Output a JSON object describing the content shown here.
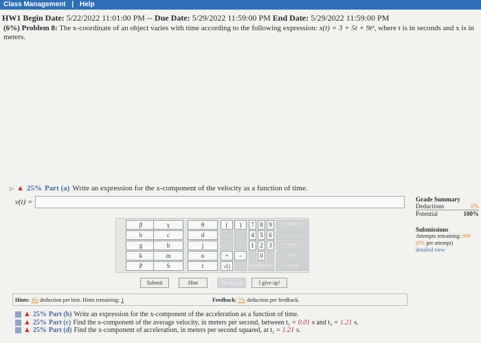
{
  "topbar": {
    "class_management": "Class Management",
    "separator": "|",
    "help": "Help"
  },
  "dates": {
    "hw": "HW1",
    "begin_label": "Begin Date:",
    "begin": "5/22/2022 11:01:00 PM",
    "dash": "--",
    "due_label": "Due Date:",
    "due": "5/29/2022 11:59:00 PM",
    "end_label": "End Date:",
    "end": "5/29/2022 11:59:00 PM"
  },
  "problem": {
    "heading": "(6%) Problem 8:",
    "text_1": "The x-coordinate of an object varies with time according to the following expression:",
    "expression": "x(t) = 3 + 5t + 9t²",
    "text_2": ", where t is in seconds and x is in",
    "text_3": "meters."
  },
  "part_a": {
    "pct": "25%",
    "label": "Part (a)",
    "question": "Write an expression for the x-component of the velocity as a function of time.",
    "answer_label": "v(t) =",
    "answer_value": ""
  },
  "grade_summary": {
    "title": "Grade Summary",
    "deductions_label": "Deductions",
    "deductions_value": "0%",
    "potential_label": "Potential",
    "potential_value": "100%"
  },
  "submissions": {
    "title": "Submissions",
    "attempts_label": "Attempts remaining:",
    "attempts_value": "999",
    "per_attempt_pct": "(0%",
    "per_attempt_text": "per attempt)",
    "detailed_view": "detailed view"
  },
  "keypad": {
    "vars": [
      [
        "β",
        "γ",
        "θ"
      ],
      [
        "b",
        "c",
        "d"
      ],
      [
        "g",
        "h",
        "j"
      ],
      [
        "k",
        "m",
        "n"
      ],
      [
        "P",
        "S",
        "t"
      ]
    ],
    "open_paren": "(",
    "close_paren": ")",
    "digits": [
      [
        "7",
        "8",
        "9"
      ],
      [
        "4",
        "5",
        "6"
      ],
      [
        "1",
        "2",
        "3"
      ]
    ],
    "zero": "0",
    "plus": "+",
    "minus": "-",
    "sqrt": "√()",
    "home": "HOME",
    "end": "END",
    "del": "DEL",
    "backspace": "BACKSPACE",
    "clear": "CLEAR"
  },
  "buttons": {
    "submit": "Submit",
    "hint": "Hint",
    "feedback": "Feedback",
    "give_up": "I give up!"
  },
  "hints": {
    "label": "Hints:",
    "pct": "4%",
    "text": "deduction per hint. Hints remaining:",
    "remaining": "1",
    "feedback_label": "Feedback:",
    "feedback_pct": "5%",
    "feedback_text": "deduction per feedback."
  },
  "other_parts": [
    {
      "pct": "25%",
      "label": "Part (b)",
      "text": "Write an expression for the x-component of the acceleration as a function of time."
    },
    {
      "pct": "25%",
      "label": "Part (c)",
      "text": "Find the x-component of the average velocity, in meters per second, between t₁ =",
      "v1": "0.01",
      "mid": "s and t₂ =",
      "v2": "1.21",
      "end": "s."
    },
    {
      "pct": "25%",
      "label": "Part (d)",
      "text": "Find the x-component of acceleration, in meters per second squared, at t₂ =",
      "v2": "1.21",
      "end": "s."
    }
  ]
}
